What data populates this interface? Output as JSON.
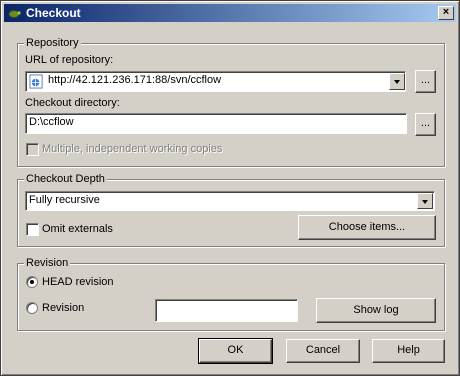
{
  "window": {
    "title": "Checkout",
    "close_label": "×"
  },
  "repository": {
    "legend": "Repository",
    "url_label": "URL of repository:",
    "url_value": "http://42.121.236.171:88/svn/ccflow",
    "browse_label": "...",
    "dir_label": "Checkout directory:",
    "dir_value": "D:\\ccflow",
    "dir_browse_label": "...",
    "multiple_label": "Multiple, independent working copies"
  },
  "depth": {
    "legend": "Checkout Depth",
    "selected": "Fully recursive",
    "omit_label": "Omit externals",
    "choose_label": "Choose items..."
  },
  "revision": {
    "legend": "Revision",
    "head_label": "HEAD revision",
    "revision_label": "Revision",
    "revision_value": "",
    "show_log_label": "Show log"
  },
  "footer": {
    "ok_label": "OK",
    "cancel_label": "Cancel",
    "help_label": "Help"
  }
}
